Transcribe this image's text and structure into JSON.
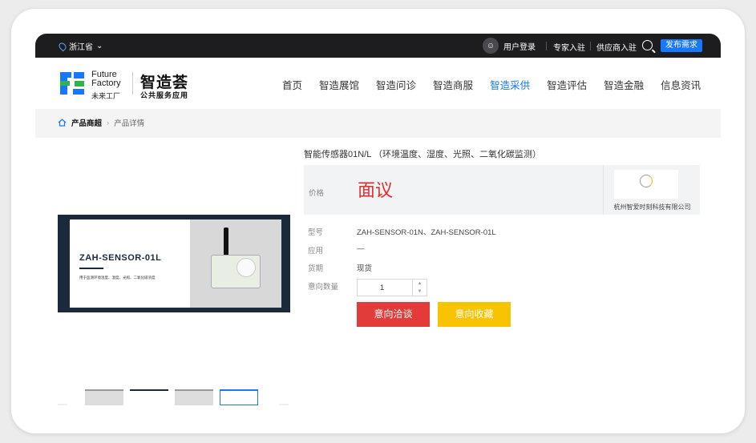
{
  "topbar": {
    "location": "浙江省",
    "login": "用户登录",
    "expert": "专家入驻",
    "supplier": "供应商入驻",
    "publish": "发布需求"
  },
  "header": {
    "logo_en_line1": "Future",
    "logo_en_line2": "Factory",
    "logo_cn_small": "未来工厂",
    "logo_cn_big": "智造荟",
    "logo_cn_sub": "公共服务应用",
    "nav": [
      "首页",
      "智造展馆",
      "智造问诊",
      "智造商服",
      "智造采供",
      "智造评估",
      "智造金融",
      "信息资讯"
    ],
    "active_nav": "智造采供"
  },
  "breadcrumb": {
    "root": "产品商超",
    "current": "产品详情"
  },
  "product": {
    "title": "智能传感器01N/L （环境温度、湿度、光照、二氧化碳监测）",
    "image_model": "ZAH-SENSOR-01L",
    "image_desc": "用于监测环境温度、湿度、光照、二氧化碳浓度",
    "price_label": "价格",
    "price_value": "面议",
    "company_name": "杭州智爱时刻科技有限公司",
    "specs": [
      {
        "label": "型号",
        "value": "ZAH-SENSOR-01N、ZAH-SENSOR-01L"
      },
      {
        "label": "应用",
        "value": "—"
      },
      {
        "label": "货期",
        "value": "现货"
      },
      {
        "label": "意向数量",
        "value": ""
      }
    ],
    "quantity": "1",
    "btn_negotiate": "意向洽谈",
    "btn_favorite": "意向收藏"
  },
  "colors": {
    "accent": "#1677ff",
    "price": "#e52b2b",
    "negotiate": "#e33a3a",
    "favorite": "#f8c300"
  }
}
